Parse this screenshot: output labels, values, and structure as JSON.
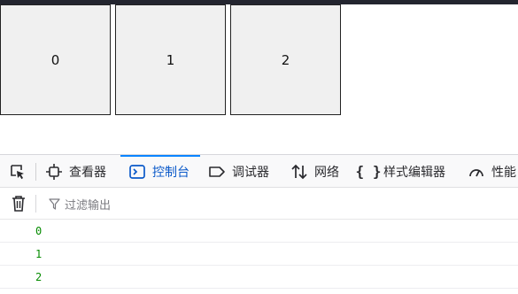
{
  "page": {
    "boxes": [
      "0",
      "1",
      "2"
    ]
  },
  "devtools": {
    "tabs": [
      {
        "label": "查看器",
        "icon": "inspector-icon"
      },
      {
        "label": "控制台",
        "icon": "console-icon",
        "active": true
      },
      {
        "label": "调试器",
        "icon": "debugger-icon"
      },
      {
        "label": "网络",
        "icon": "network-icon"
      },
      {
        "label": "样式编辑器",
        "icon": "style-editor-icon"
      },
      {
        "label": "性能",
        "icon": "performance-icon"
      }
    ],
    "filter_placeholder": "过滤输出",
    "console_output": [
      "0",
      "1",
      "2"
    ]
  },
  "colors": {
    "active_tab": "#0a59c9",
    "log_text": "#058b00",
    "box_bg": "#f0f0f0"
  }
}
